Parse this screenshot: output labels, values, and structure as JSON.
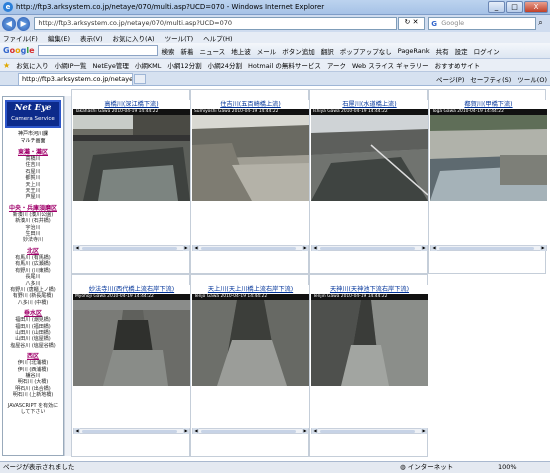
{
  "window": {
    "title": "http://ftp3.arksystem.co.jp/netaye/070/multi.asp?UCD=070 - Windows Internet Explorer",
    "btn_min": "_",
    "btn_max": "□",
    "btn_close": "X"
  },
  "address": {
    "url": "http://ftp3.arksystem.co.jp/netaye/070/multi.asp?UCD=070",
    "search_placeholder": "Google"
  },
  "menu": [
    "ファイル(F)",
    "編集(E)",
    "表示(V)",
    "お気に入り(A)",
    "ツール(T)",
    "ヘルプ(H)"
  ],
  "google_toolbar": {
    "logo": "Google",
    "items": [
      "検索",
      "新着",
      "ニュース",
      "地上波",
      "メール",
      "ボタン追加",
      "翻訳",
      "ポップアップなし",
      "PageRank",
      "共有",
      "設定",
      "ログイン"
    ]
  },
  "favorites": {
    "label": "お気に入り",
    "items": [
      "小網IP一覧",
      "NetEye管理",
      "小網KML",
      "小網12分割",
      "小網24分割",
      "Hotmail の無料サービス",
      "アーク",
      "Web スライス ギャラリー",
      "おすすめサイト"
    ]
  },
  "tab": {
    "label": "http://ftp3.arksystem.co.jp/netaye/070/",
    "commands": [
      "ページ(P)",
      "セーフティ(S)",
      "ツール(O)"
    ]
  },
  "sidebar": {
    "logo_title": "Net Eye",
    "logo_subtitle": "Camera Service",
    "subtitle_1": "神戸市河川課",
    "subtitle_2": "マルチ画面",
    "groups": [
      {
        "name": "東灘・灘区",
        "items": [
          "高橋川",
          "住吉川",
          "石屋川",
          "都賀川",
          "天上川",
          "天王川",
          "芦屋川"
        ]
      },
      {
        "name": "中央・兵庫須磨区",
        "items": [
          "新湊川 (湊川公園)",
          "新湊川 (石井橋)",
          "宇治川",
          "生田川",
          "妙法寺川"
        ]
      },
      {
        "name": "北区",
        "items": [
          "有馬川 (有馬橋)",
          "有馬川 (広瀬橋)",
          "有野川 (川東橋)",
          "長尾川",
          "八多川",
          "有野川 (唐櫃上ノ橋)",
          "有野川 (新長尾橋)",
          "八多川 (中橋)"
        ]
      },
      {
        "name": "垂水区",
        "items": [
          "福田川 (潮見橋)",
          "福田川 (福田橋)",
          "山田川 (山田橋)",
          "山田川 (塩屋橋)",
          "塩屋谷川 (塩屋谷橋)"
        ]
      },
      {
        "name": "西区",
        "items": [
          "伊川 (北浦橋)",
          "伊川 (西浦橋)",
          "櫨谷川",
          "明石川 (大橋)",
          "明石川 (出合橋)",
          "明石川 (上新地橋)"
        ]
      }
    ],
    "footer_1": "JAVASCRIPT を有効に",
    "footer_2": "して下さい"
  },
  "cameras": [
    {
      "name": "高橋川(深江橋下流)",
      "overlay": "Takahashi Gawa 2010-04-19 14:44:22"
    },
    {
      "name": "住吉川(五百崎橋上流)",
      "overlay": "Sumiyoshi Gawa 2010-04-19 14:44:22"
    },
    {
      "name": "石屋川(水道橋上流)",
      "overlay": "Ishiya Gawa 2010-04-19 14:44:22"
    },
    {
      "name": "都賀川(甲橋下流)",
      "overlay": "Toga Gawa 2010-04-19 14:44:22"
    },
    {
      "name": "妙法寺川(西代橋上流右岸下流)",
      "overlay": "Myohoji Gawa 2010-04-19 14:44:22"
    },
    {
      "name": "天上川(天上川橋上流右岸下流)",
      "overlay": "Tenjo Gawa 2010-04-19 14:44:22"
    },
    {
      "name": "天神川(天神池下流右岸下流)",
      "overlay": "Tenjin Gawa 2010-04-19 14:44:22"
    }
  ],
  "status": {
    "text": "ページが表示されました",
    "zone": "インターネット",
    "zoom": "100%"
  }
}
